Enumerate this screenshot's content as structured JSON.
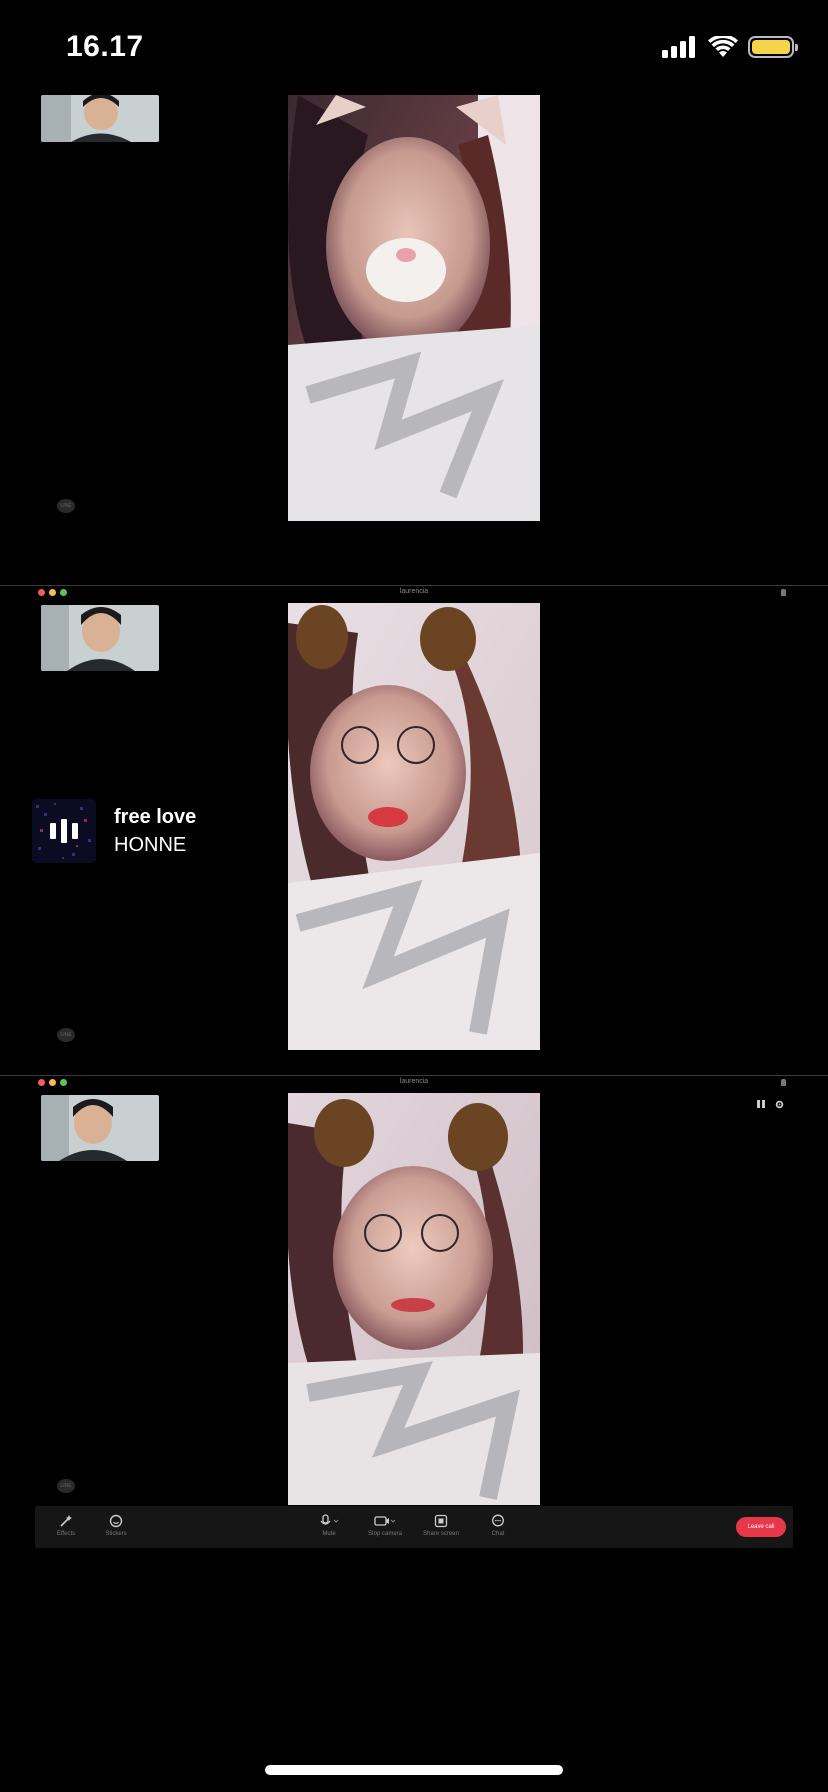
{
  "status_bar": {
    "time": "16.17",
    "battery_color": "#f5d34a"
  },
  "frames": [
    {
      "window_title": "",
      "show_titlebar": false,
      "filter": "cat-ears"
    },
    {
      "window_title": "laurencia",
      "show_titlebar": true,
      "filter": "dog-ears"
    },
    {
      "window_title": "laurencia",
      "show_titlebar": true,
      "filter": "dog-ears"
    }
  ],
  "badge_text": "LINE",
  "now_playing": {
    "title": "free love",
    "artist": "HONNE"
  },
  "toolbar": {
    "effects_label": "Effects",
    "stickers_label": "Stickers",
    "mute_label": "Mute",
    "stop_camera_label": "Stop camera",
    "share_screen_label": "Share screen",
    "chat_label": "Chat",
    "leave_label": "Leave call",
    "leave_color": "#e8364a"
  },
  "colors": {
    "traffic_red": "#ee5f57",
    "traffic_yellow": "#f6be4f",
    "traffic_green": "#60c454"
  }
}
